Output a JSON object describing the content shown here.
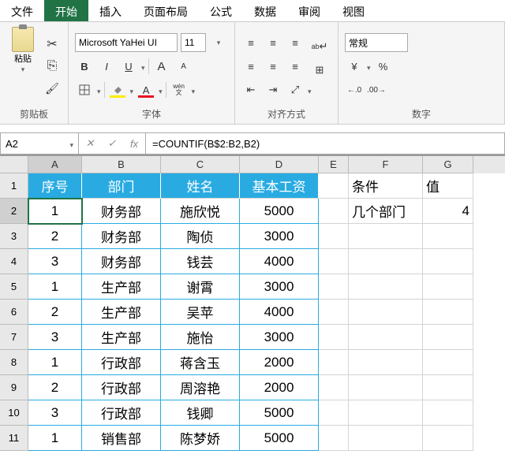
{
  "menu": {
    "items": [
      "文件",
      "开始",
      "插入",
      "页面布局",
      "公式",
      "数据",
      "审阅",
      "视图"
    ],
    "active": 1
  },
  "ribbon": {
    "clipboard": {
      "label": "剪贴板",
      "paste": "粘贴"
    },
    "font": {
      "label": "字体",
      "name": "Microsoft YaHei UI",
      "size": "11",
      "bold": "B",
      "italic": "I",
      "underline": "U",
      "strike": "ab",
      "grow": "A",
      "shrink": "A",
      "wen": "wén",
      "wen2": "文"
    },
    "align": {
      "label": "对齐方式",
      "wrap": "ab",
      "merge": ""
    },
    "number": {
      "label": "数字",
      "format": "常规"
    }
  },
  "nameBox": "A2",
  "formula": "=COUNTIF(B$2:B2,B2)",
  "fx": "fx",
  "cols": [
    "A",
    "B",
    "C",
    "D",
    "E",
    "F",
    "G"
  ],
  "rows": [
    "1",
    "2",
    "3",
    "4",
    "5",
    "6",
    "7",
    "8",
    "9",
    "10",
    "11"
  ],
  "headers": {
    "A": "序号",
    "B": "部门",
    "C": "姓名",
    "D": "基本工资"
  },
  "side": {
    "F1": "条件",
    "G1": "值",
    "F2": "几个部门",
    "G2": "4"
  },
  "data": [
    {
      "A": "1",
      "B": "财务部",
      "C": "施欣悦",
      "D": "5000"
    },
    {
      "A": "2",
      "B": "财务部",
      "C": "陶侦",
      "D": "3000"
    },
    {
      "A": "3",
      "B": "财务部",
      "C": "钱芸",
      "D": "4000"
    },
    {
      "A": "1",
      "B": "生产部",
      "C": "谢霄",
      "D": "3000"
    },
    {
      "A": "2",
      "B": "生产部",
      "C": "吴苹",
      "D": "4000"
    },
    {
      "A": "3",
      "B": "生产部",
      "C": "施怡",
      "D": "3000"
    },
    {
      "A": "1",
      "B": "行政部",
      "C": "蒋含玉",
      "D": "2000"
    },
    {
      "A": "2",
      "B": "行政部",
      "C": "周溶艳",
      "D": "2000"
    },
    {
      "A": "3",
      "B": "行政部",
      "C": "钱卿",
      "D": "5000"
    },
    {
      "A": "1",
      "B": "销售部",
      "C": "陈梦娇",
      "D": "5000"
    }
  ]
}
